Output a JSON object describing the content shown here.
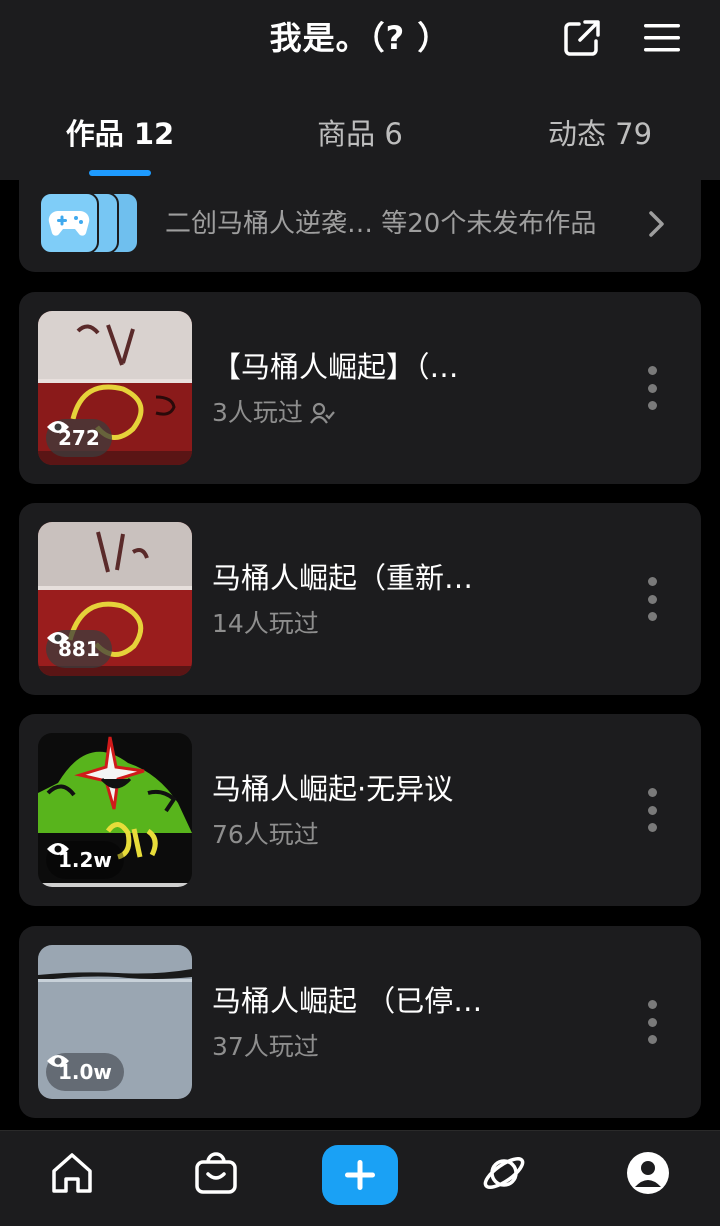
{
  "header": {
    "title": "我是。（? ）",
    "share_icon": "external-share-icon",
    "menu_icon": "hamburger-menu-icon"
  },
  "tabs": [
    {
      "label": "作品 12",
      "active": true
    },
    {
      "label": "商品 6",
      "active": false
    },
    {
      "label": "动态 79",
      "active": false
    }
  ],
  "drafts": {
    "text": "二创马桶人逆袭…  等20个未发布作品",
    "icon": "gamepad-icon"
  },
  "works": [
    {
      "title": "【马桶人崛起】（…",
      "plays": "3人玩过",
      "views": "272",
      "coop_icon": true
    },
    {
      "title": "马桶人崛起（重新…",
      "plays": "14人玩过",
      "views": "881",
      "coop_icon": false
    },
    {
      "title": "马桶人崛起·无异议",
      "plays": "76人玩过",
      "views": "1.2w",
      "coop_icon": false
    },
    {
      "title": "马桶人崛起 （已停…",
      "plays": "37人玩过",
      "views": "1.0w",
      "coop_icon": false
    }
  ],
  "bottom_nav": {
    "items": [
      "home-icon",
      "shop-bag-icon",
      "add-icon",
      "planet-icon",
      "profile-icon"
    ],
    "accent": "#1aa1f5"
  }
}
